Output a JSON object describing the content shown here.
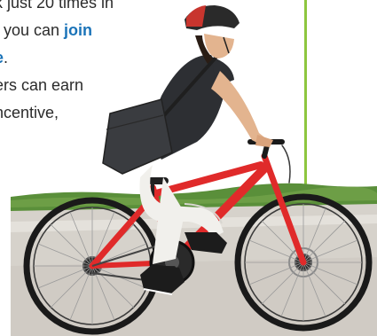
{
  "text": {
    "line1": "k just 20 times in",
    "line2_pre": ", you can ",
    "line2_link": "join",
    "line3_link": "e",
    "line3_post": ".",
    "line4": "ers can earn",
    "line5": "ncentive,"
  },
  "colors": {
    "link": "#1a73b8",
    "divider": "#8dc63f",
    "bike_frame": "#e02a2a",
    "helmet": "#c8352e",
    "grass": "#5a8f3a",
    "road": "#d6d2cb",
    "shirt": "#2d2f33",
    "pants": "#f1f0ec"
  },
  "photo": {
    "subject": "cyclist-on-red-bicycle"
  }
}
